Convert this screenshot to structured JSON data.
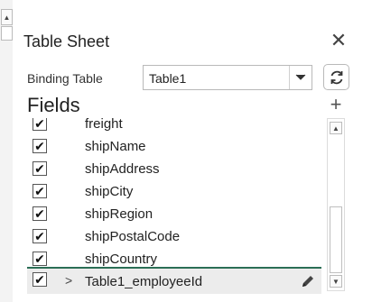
{
  "panel": {
    "title": "Table Sheet",
    "binding_label": "Binding Table",
    "binding_value": "Table1",
    "fields_title": "Fields"
  },
  "fields": [
    {
      "label": "freight",
      "checked": true
    },
    {
      "label": "shipName",
      "checked": true
    },
    {
      "label": "shipAddress",
      "checked": true
    },
    {
      "label": "shipCity",
      "checked": true
    },
    {
      "label": "shipRegion",
      "checked": true
    },
    {
      "label": "shipPostalCode",
      "checked": true
    },
    {
      "label": "shipCountry",
      "checked": true
    }
  ],
  "relation_field": {
    "label": "Table1_employeeId",
    "checked": true
  },
  "colors": {
    "accent": "#2b6e55",
    "selected_row": "#ececec"
  },
  "icons": {
    "close": "close-icon",
    "caret": "chevron-down-icon",
    "refresh": "refresh-icon",
    "add": "plus-icon",
    "expand": "chevron-right-icon",
    "edit": "pencil-icon"
  }
}
